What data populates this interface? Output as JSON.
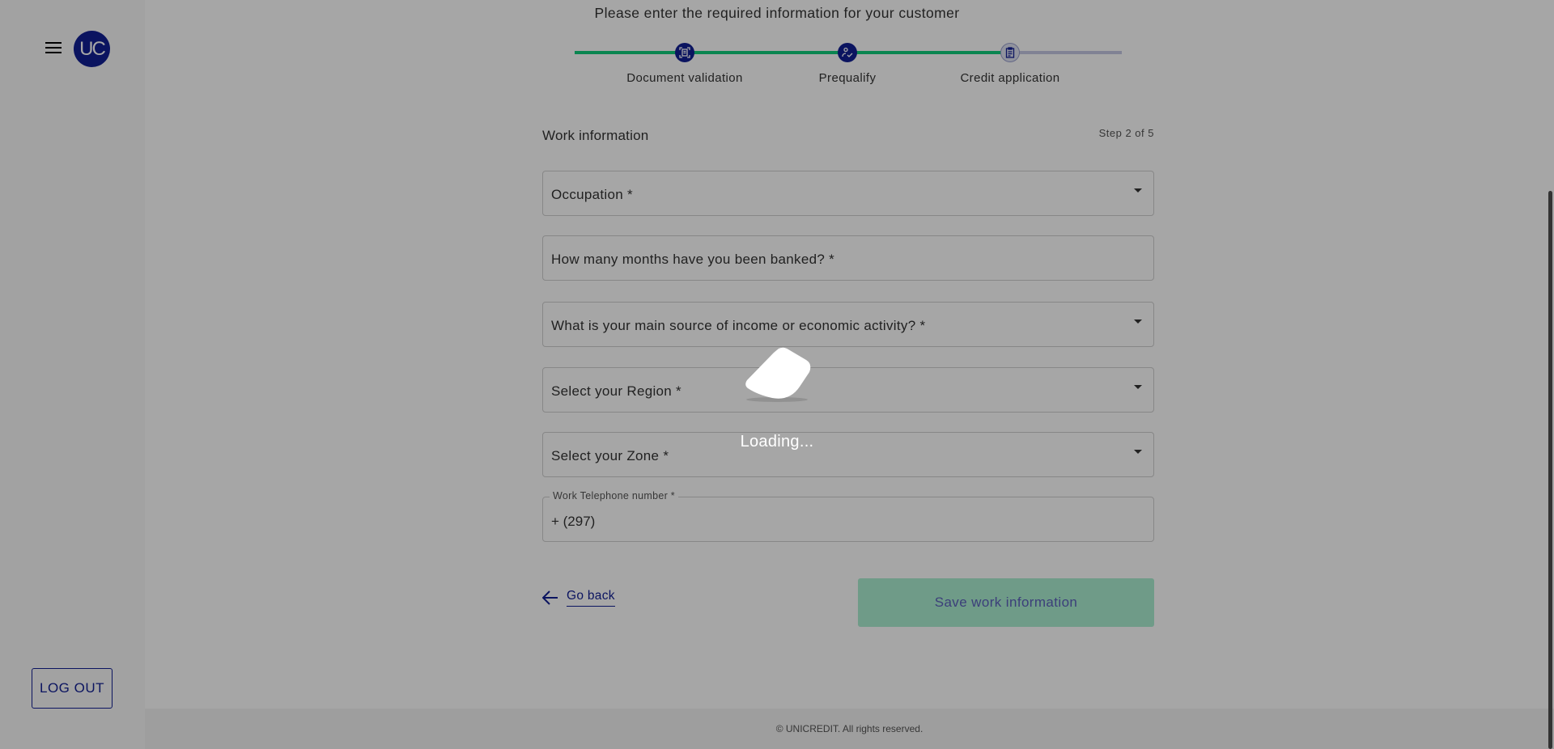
{
  "sidebar": {
    "avatar_initials": "UC",
    "logout_label": "LOG OUT",
    "menu_icon": "hamburger-icon"
  },
  "header": {
    "title": "Please enter the required information for your customer"
  },
  "stepper": {
    "steps": [
      {
        "label": "Document validation",
        "icon": "document-scan-icon",
        "status": "completed"
      },
      {
        "label": "Prequalify",
        "icon": "person-check-icon",
        "status": "completed"
      },
      {
        "label": "Credit application",
        "icon": "clipboard-icon",
        "status": "current"
      }
    ],
    "colors": {
      "completed": "#10cd7b",
      "pending": "#c5c8e3",
      "icon": "#121f94"
    }
  },
  "form": {
    "section_title": "Work information",
    "step_indicator": "Step 2 of 5",
    "fields": [
      {
        "label": "Occupation *",
        "type": "select"
      },
      {
        "label": "How many months have you been banked? *",
        "type": "text"
      },
      {
        "label": "What is your main source of income or economic activity? *",
        "type": "select"
      },
      {
        "label": "Select your Region *",
        "type": "select"
      },
      {
        "label": "Select your Zone *",
        "type": "select"
      },
      {
        "label": "Work Telephone number *",
        "type": "tel",
        "value": "+ (297)"
      }
    ],
    "go_back_label": "Go back",
    "save_label": "Save work information"
  },
  "loading": {
    "text": "Loading..."
  },
  "footer": {
    "text": "© UNICREDIT. All rights reserved."
  }
}
